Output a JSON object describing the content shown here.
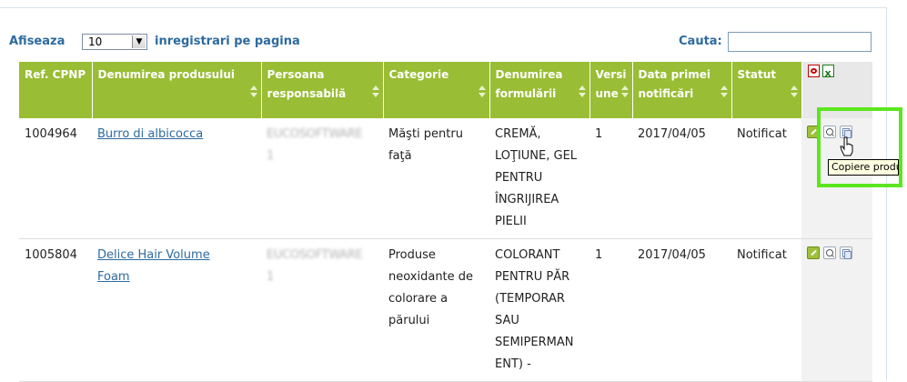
{
  "controls": {
    "show_label": "Afiseaza",
    "page_size": "10",
    "per_page_label": "inregistrari pe pagina",
    "search_label": "Cauta:",
    "search_value": ""
  },
  "table": {
    "headers": [
      [
        "Ref. CPNP"
      ],
      [
        "Denumirea produsului"
      ],
      [
        "Persoana",
        "responsabilă"
      ],
      [
        "Categorie"
      ],
      [
        "Denumirea",
        "formulării"
      ],
      [
        "Versi",
        "une"
      ],
      [
        "Data primei",
        "notificări"
      ],
      [
        "Statut"
      ]
    ],
    "rows": [
      {
        "ref": "1004964",
        "product": "Burro di albicocca",
        "person": [
          "EUCOSOFTWARE",
          "1"
        ],
        "category": [
          "Măşti pentru",
          "faţă"
        ],
        "formulation": [
          "CREMĂ,",
          "LOŢIUNE, GEL",
          "PENTRU",
          "ÎNGRIJIREA",
          "PIELII"
        ],
        "version": "1",
        "date": "2017/04/05",
        "status": "Notificat"
      },
      {
        "ref": "1005804",
        "product": [
          "Delice Hair Volume",
          "Foam"
        ],
        "person": [
          "EUCOSOFTWARE",
          "1"
        ],
        "category": [
          "Produse",
          "neoxidante de",
          "colorare a",
          "părului"
        ],
        "formulation": [
          "COLORANT",
          "PENTRU PĂR",
          "(TEMPORAR",
          "SAU",
          "SEMIPERMAN",
          "ENT) -"
        ],
        "version": "1",
        "date": "2017/04/05",
        "status": "Notificat"
      }
    ]
  },
  "tooltip": "Copiere produs",
  "colors": {
    "header_green": "#99bd34",
    "link_blue": "#2d6a9f",
    "highlight_green": "#5ce620"
  },
  "icons": [
    "pdf-export-icon",
    "excel-export-icon",
    "edit-icon",
    "view-icon",
    "copy-icon",
    "hand-cursor-icon"
  ]
}
